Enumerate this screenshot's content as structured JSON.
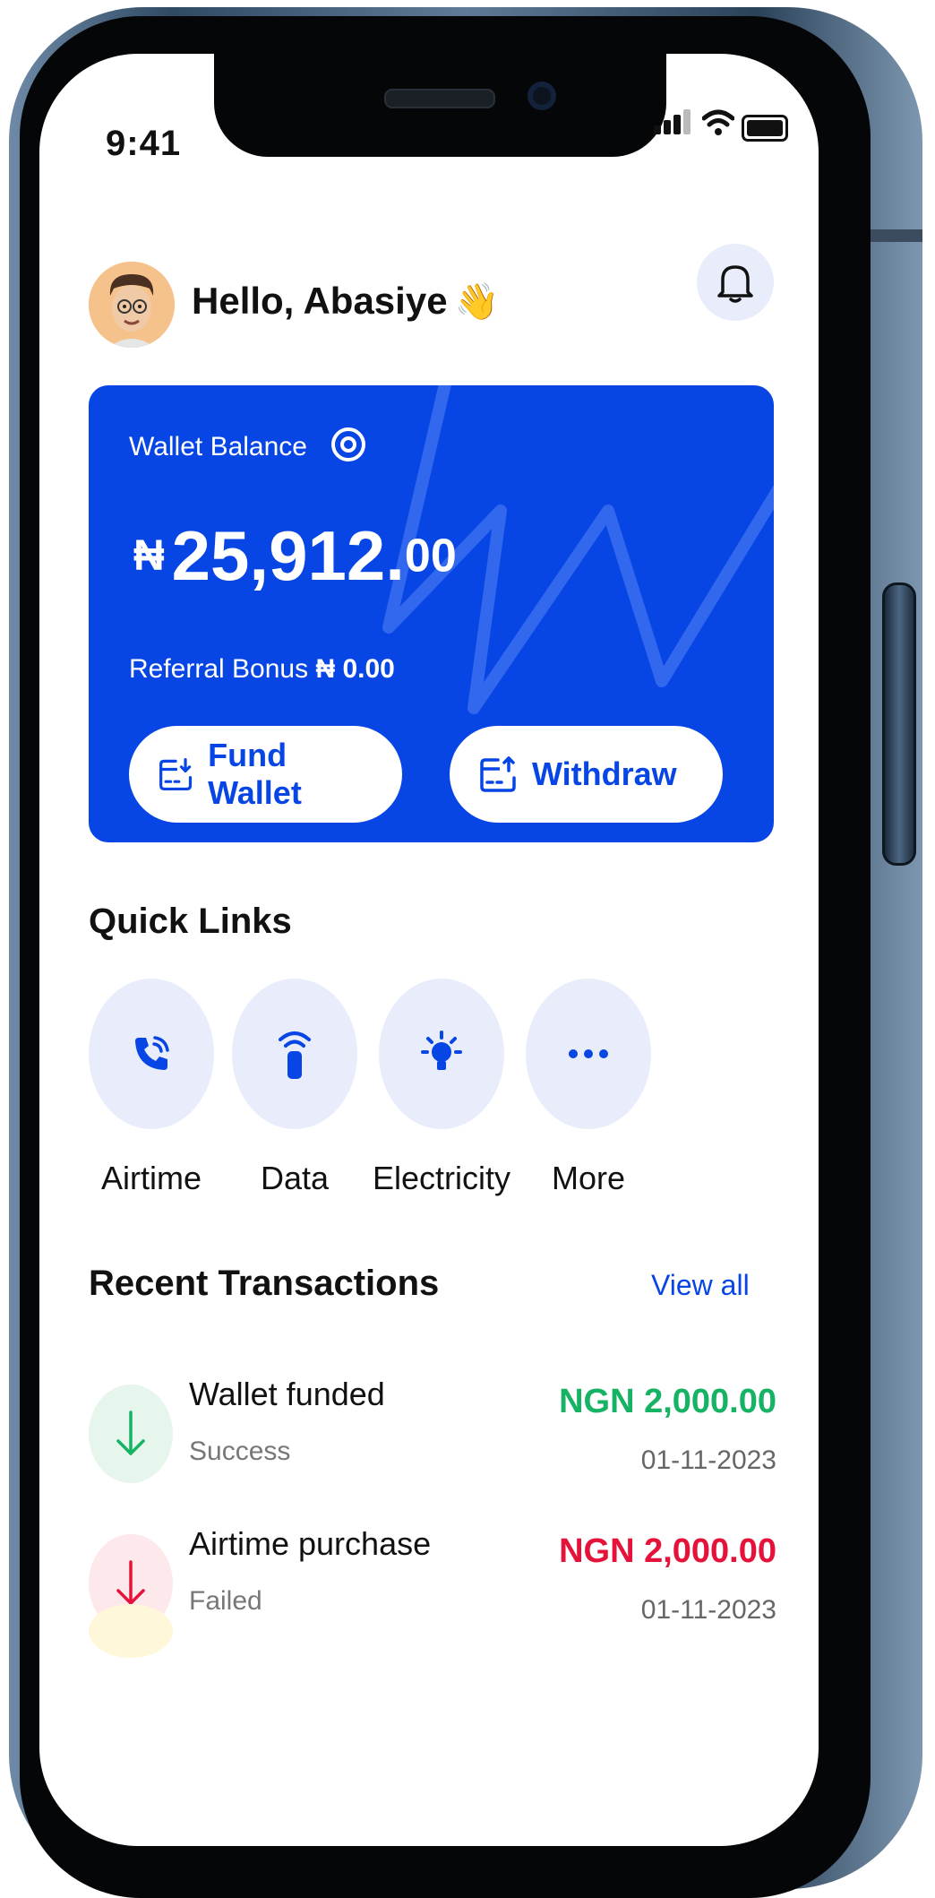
{
  "status_bar": {
    "time": "9:41"
  },
  "header": {
    "greeting": "Hello, Abasiye",
    "wave_emoji": "👋"
  },
  "wallet": {
    "label": "Wallet Balance",
    "currency_symbol": "₦",
    "balance_main": "25,912.",
    "balance_decimal": "00",
    "referral_label": "Referral Bonus",
    "referral_amount": "₦ 0.00",
    "fund_button": "Fund Wallet",
    "withdraw_button": "Withdraw"
  },
  "quick_links": {
    "title": "Quick Links",
    "items": [
      {
        "label": "Airtime",
        "icon": "phone-call-icon"
      },
      {
        "label": "Data",
        "icon": "data-signal-icon"
      },
      {
        "label": "Electricity",
        "icon": "bulb-icon"
      },
      {
        "label": "More",
        "icon": "more-dots-icon"
      }
    ]
  },
  "transactions": {
    "title": "Recent Transactions",
    "view_all": "View all",
    "items": [
      {
        "title": "Wallet funded",
        "status": "Success",
        "amount": "NGN 2,000.00",
        "date": "01-11-2023",
        "amount_color": "#16b364",
        "icon_bg": "#e6f6ec",
        "arrow_color": "#16b364"
      },
      {
        "title": "Airtime purchase",
        "status": "Failed",
        "amount": "NGN 2,000.00",
        "date": "01-11-2023",
        "amount_color": "#e5133a",
        "icon_bg": "#fde8ec",
        "arrow_color": "#e5133a"
      }
    ]
  },
  "colors": {
    "brand": "#0746e4",
    "light_tint": "#e8ecfb"
  }
}
